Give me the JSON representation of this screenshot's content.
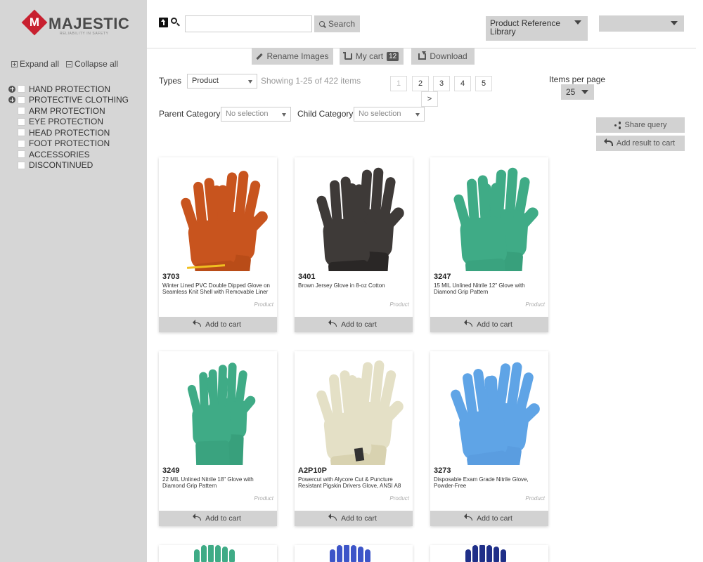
{
  "brand": {
    "name": "MAJESTIC",
    "mark": "M",
    "tagline": "Reliability in Safety",
    "color": "#c8202f"
  },
  "sidebar": {
    "expand_all": "Expand all",
    "collapse_all": "Collapse all",
    "categories": [
      {
        "label": "HAND PROTECTION",
        "expandable": true
      },
      {
        "label": "PROTECTIVE CLOTHING",
        "expandable": true
      },
      {
        "label": "ARM PROTECTION",
        "expandable": false
      },
      {
        "label": "EYE PROTECTION",
        "expandable": false
      },
      {
        "label": "HEAD PROTECTION",
        "expandable": false
      },
      {
        "label": "FOOT PROTECTION",
        "expandable": false
      },
      {
        "label": "ACCESSORIES",
        "expandable": false
      },
      {
        "label": "DISCONTINUED",
        "expandable": false
      }
    ]
  },
  "header": {
    "search_placeholder": "",
    "search_value": "",
    "search_label": "Search",
    "library_select": "Product Reference Library",
    "user_select": ""
  },
  "toolbar": {
    "rename_label": "Rename Images",
    "cart_label": "My cart",
    "cart_count": "12",
    "download_label": "Download"
  },
  "filters": {
    "types_label": "Types",
    "types_value": "Product",
    "showing": "Showing 1-25 of 422 items",
    "parent_label": "Parent Category",
    "parent_value": "No selection",
    "child_label": "Child Category",
    "child_value": "No selection"
  },
  "pagination": {
    "pages": [
      "1",
      "2",
      "3",
      "4",
      "5"
    ],
    "next": ">",
    "current": "1"
  },
  "items_per_page": {
    "label": "Items per page",
    "value": "25"
  },
  "actions": {
    "share": "Share query",
    "add_result": "Add result to cart"
  },
  "products": [
    {
      "code": "3703",
      "description": "Winter Lined PVC Double Dipped Glove on Seamless Knit Shell with Removable Liner",
      "type": "Product",
      "add_label": "Add to cart",
      "glove": "orange"
    },
    {
      "code": "3401",
      "description": "Brown Jersey Glove in 8-oz Cotton",
      "type": "Product",
      "add_label": "Add to cart",
      "glove": "brown"
    },
    {
      "code": "3247",
      "description": "15 MIL Unlined Nitrile 12\" Glove with Diamond Grip Pattern",
      "type": "Product",
      "add_label": "Add to cart",
      "glove": "green-short"
    },
    {
      "code": "3249",
      "description": "22 MIL Unlined Nitrile 18\" Glove with Diamond Grip Pattern",
      "type": "Product",
      "add_label": "Add to cart",
      "glove": "green-long"
    },
    {
      "code": "A2P10P",
      "description": "Powercut with Alycore Cut & Puncture Resistant Pigskin Drivers Glove, ANSI A8",
      "type": "Product",
      "add_label": "Add to cart",
      "glove": "cream"
    },
    {
      "code": "3273",
      "description": "Disposable Exam Grade Nitrile Glove, Powder-Free",
      "type": "Product",
      "add_label": "Add to cart",
      "glove": "blue"
    }
  ],
  "colors": {
    "sidebar_bg": "#d6d6d6",
    "button_bg": "#d2d2d2",
    "glove_orange": "#c8541e",
    "glove_brown": "#3e3a38",
    "glove_green": "#3fab86",
    "glove_cream": "#e4e0c6",
    "glove_blue": "#5fa4e6",
    "glove_royal": "#3d55c8",
    "glove_navy": "#1f2f88"
  }
}
